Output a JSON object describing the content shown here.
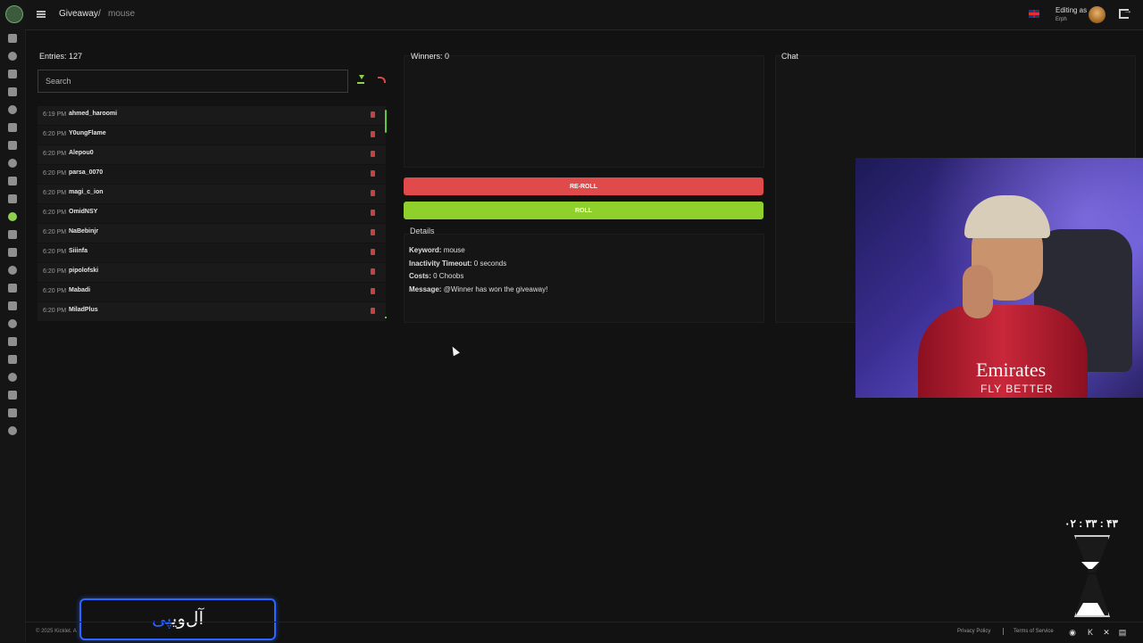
{
  "header": {
    "breadcrumb": [
      "Giveaway",
      "mouse"
    ],
    "breadcrumb_sep": "/",
    "editing_label": "Editing as",
    "editing_user": "Erph"
  },
  "sidebar_icons": [
    "home-icon",
    "document-icon",
    "wrench-icon",
    "hammer-icon",
    "chat-icon",
    "clock-icon",
    "shield-icon",
    "warning-icon",
    "music-icon",
    "star-icon",
    "gift-icon",
    "cart-icon",
    "link-icon",
    "chart-icon",
    "video-icon",
    "file-icon",
    "smile-icon",
    "clapper-icon",
    "comment-icon",
    "monitor-icon",
    "search-icon",
    "gamepad-icon",
    "id-card-icon"
  ],
  "entries_panel": {
    "title": "Entries: 127",
    "search_placeholder": "Search",
    "entries": [
      {
        "time": "6:19 PM",
        "name": "ahmed_haroomi"
      },
      {
        "time": "6:20 PM",
        "name": "Y0ungFlame"
      },
      {
        "time": "6:20 PM",
        "name": "Alepou0"
      },
      {
        "time": "6:20 PM",
        "name": "parsa_0070"
      },
      {
        "time": "6:20 PM",
        "name": "magi_c_ion"
      },
      {
        "time": "6:20 PM",
        "name": "OmidNSY"
      },
      {
        "time": "6:20 PM",
        "name": "NaBebinjr"
      },
      {
        "time": "6:20 PM",
        "name": "Siiinfa"
      },
      {
        "time": "6:20 PM",
        "name": "pipolofski"
      },
      {
        "time": "6:20 PM",
        "name": "Mabadi"
      },
      {
        "time": "6:20 PM",
        "name": "MiladPlus"
      }
    ]
  },
  "winners_panel": {
    "title": "Winners: 0",
    "reroll_label": "RE-ROLL",
    "roll_label": "ROLL"
  },
  "details": {
    "title": "Details",
    "keyword_label": "Keyword:",
    "keyword_value": "mouse",
    "timeout_label": "Inactivity Timeout:",
    "timeout_value": "0 seconds",
    "costs_label": "Costs:",
    "costs_value": "0 Choobs",
    "message_label": "Message:",
    "message_value": "@Winner has won the giveaway!"
  },
  "chat_panel": {
    "title": "Chat"
  },
  "webcam": {
    "shirt_text": "Emirates",
    "shirt_text2": "FLY BETTER"
  },
  "overlay": {
    "timer": "۰۲ : ۳۳ : ۴۳",
    "brand_text_white": "آل‌وی",
    "brand_text_blue": "پی"
  },
  "footer": {
    "copyright": "© 2025 Kicklet. A",
    "privacy": "Privacy Policy",
    "terms": "Terms of Service"
  },
  "colors": {
    "accent_green": "#8fd12a",
    "danger_red": "#e14a4a",
    "brand_blue": "#2a66ff"
  }
}
